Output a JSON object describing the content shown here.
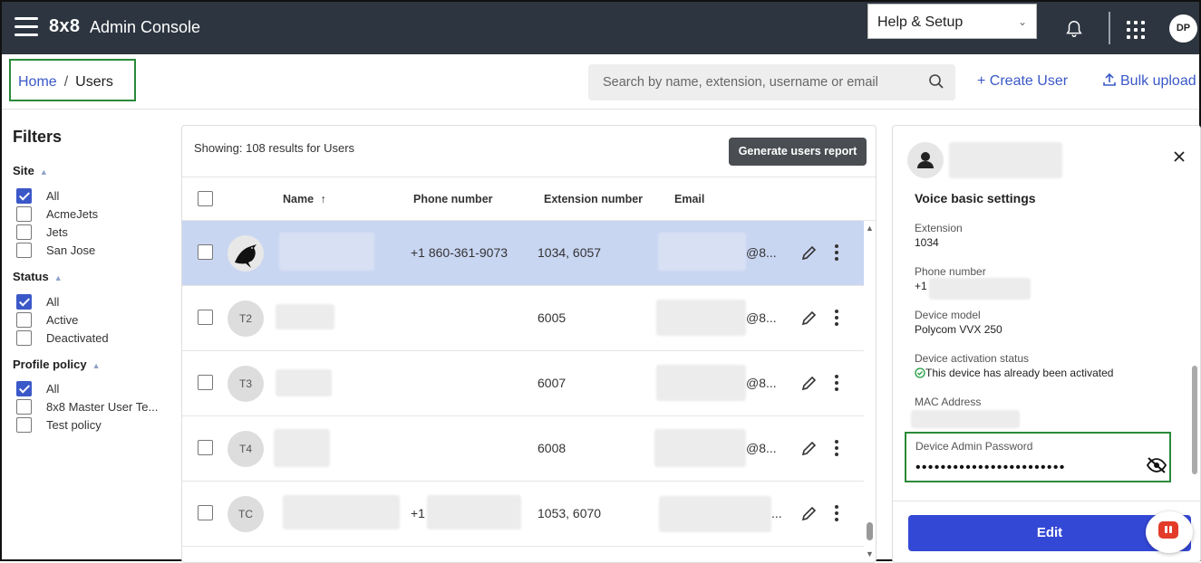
{
  "header": {
    "brand": "8x8",
    "app_name": "Admin Console",
    "help_label": "Help & Setup",
    "user_initials": "DP"
  },
  "breadcrumb": {
    "home": "Home",
    "sep": "/",
    "current": "Users"
  },
  "search": {
    "placeholder": "Search by name, extension, username or email"
  },
  "actions": {
    "create": "+ Create User",
    "bulk": "Bulk upload"
  },
  "filters": {
    "title": "Filters",
    "site": {
      "label": "Site",
      "items": [
        {
          "label": "All",
          "checked": true
        },
        {
          "label": "AcmeJets",
          "checked": false
        },
        {
          "label": "Jets",
          "checked": false
        },
        {
          "label": "San Jose",
          "checked": false
        }
      ]
    },
    "status": {
      "label": "Status",
      "items": [
        {
          "label": "All",
          "checked": true
        },
        {
          "label": "Active",
          "checked": false
        },
        {
          "label": "Deactivated",
          "checked": false
        }
      ]
    },
    "profile": {
      "label": "Profile policy",
      "items": [
        {
          "label": "All",
          "checked": true
        },
        {
          "label": "8x8 Master User Te...",
          "checked": false
        },
        {
          "label": "Test policy",
          "checked": false
        }
      ]
    }
  },
  "table": {
    "showing": "Showing: 108 results for Users",
    "report_button": "Generate users report",
    "columns": {
      "name": "Name",
      "sort": "↑",
      "phone": "Phone number",
      "extension": "Extension number",
      "email": "Email"
    },
    "rows": [
      {
        "initials": "",
        "phone": "+1 860-361-9073",
        "extension": "1034, 6057",
        "email_suffix": "@8...",
        "selected": true
      },
      {
        "initials": "T2",
        "phone": "",
        "extension": "6005",
        "email_suffix": "@8...",
        "selected": false
      },
      {
        "initials": "T3",
        "phone": "",
        "extension": "6007",
        "email_suffix": "@8...",
        "selected": false
      },
      {
        "initials": "T4",
        "phone": "",
        "extension": "6008",
        "email_suffix": "@8...",
        "selected": false
      },
      {
        "initials": "TC",
        "phone": "+1",
        "extension": "1053, 6070",
        "email_suffix": "...",
        "selected": false
      }
    ]
  },
  "panel": {
    "section": "Voice basic settings",
    "extension_label": "Extension",
    "extension_value": "1034",
    "phone_label": "Phone number",
    "phone_value": "+1",
    "model_label": "Device model",
    "model_value": "Polycom VVX 250",
    "activation_label": "Device activation status",
    "activation_value": "This device has already been activated",
    "mac_label": "MAC Address",
    "password_label": "Device Admin Password",
    "password_value": "••••••••••••••••••••••••",
    "edit_button": "Edit"
  },
  "colors": {
    "topbar": "#2d3540",
    "accent": "#3a58c8",
    "edit": "#3448d6",
    "highlight": "#2a8a3a",
    "selected_row": "#c9d6f2"
  }
}
